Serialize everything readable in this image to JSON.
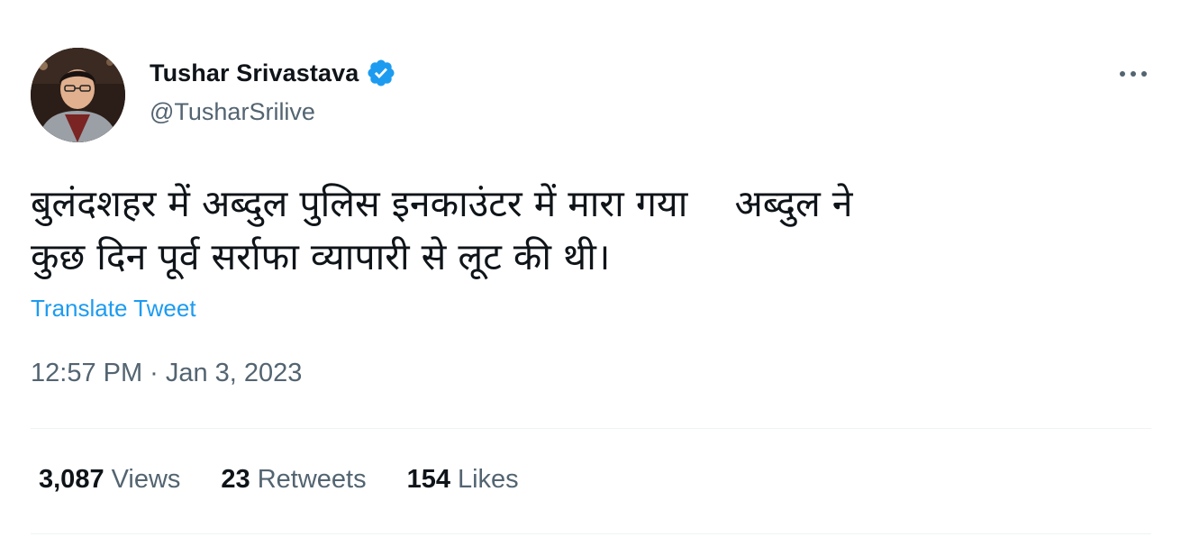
{
  "author": {
    "name": "Tushar Srivastava",
    "handle": "@TusharSrilive",
    "verified": true,
    "verified_color": "#1d9bf0"
  },
  "tweet": {
    "text": "बुलंदशहर में अब्दुल पुलिस इनकाउंटर में मारा गया    अब्दुल ने\nकुछ दिन पूर्व सर्राफा व्यापारी से लूट की थी।",
    "translate_label": "Translate Tweet",
    "time": "12:57 PM",
    "separator": "·",
    "date": "Jan 3, 2023"
  },
  "stats": {
    "views_count": "3,087",
    "views_label": "Views",
    "retweets_count": "23",
    "retweets_label": "Retweets",
    "likes_count": "154",
    "likes_label": "Likes"
  },
  "icons": {
    "more": "more-horizontal-icon",
    "verified": "verified-badge-icon"
  },
  "colors": {
    "text_primary": "#0f1419",
    "text_secondary": "#536471",
    "link": "#1d9bf0",
    "divider": "#eff3f4"
  }
}
